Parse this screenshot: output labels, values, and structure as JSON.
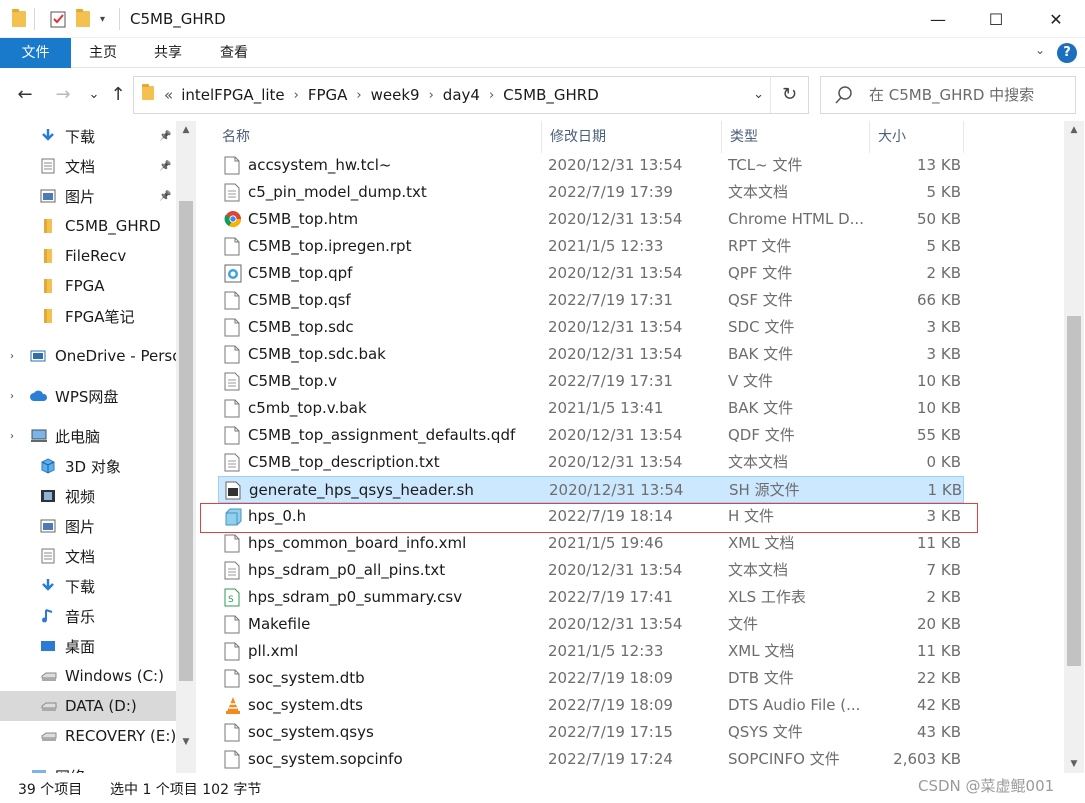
{
  "window": {
    "title": "C5MB_GHRD",
    "minimize": "—",
    "maximize": "☐",
    "close": "✕"
  },
  "ribbon": {
    "tabs": [
      "文件",
      "主页",
      "共享",
      "查看"
    ],
    "collapse": "⌄",
    "help": "?"
  },
  "address": {
    "back": "←",
    "forward": "→",
    "recent": "⌄",
    "up": "↑",
    "overflow": "«",
    "crumbs": [
      "intelFPGA_lite",
      "FPGA",
      "week9",
      "day4",
      "C5MB_GHRD"
    ],
    "dropdown": "⌄",
    "refresh": "↻"
  },
  "search": {
    "placeholder": "在 C5MB_GHRD 中搜索"
  },
  "nav": {
    "items": [
      {
        "label": "下载",
        "icon": "download-icon",
        "pinned": true
      },
      {
        "label": "文档",
        "icon": "document-icon",
        "pinned": true
      },
      {
        "label": "图片",
        "icon": "picture-icon",
        "pinned": true
      },
      {
        "label": "C5MB_GHRD",
        "icon": "folder-icon",
        "pinned": false
      },
      {
        "label": "FileRecv",
        "icon": "folder-icon",
        "pinned": false
      },
      {
        "label": "FPGA",
        "icon": "folder-icon",
        "pinned": false
      },
      {
        "label": "FPGA笔记",
        "icon": "folder-icon",
        "pinned": false
      },
      {
        "label": "OneDrive - Perso",
        "icon": "onedrive-icon",
        "pinned": false
      },
      {
        "label": "WPS网盘",
        "icon": "cloud-icon",
        "pinned": false
      },
      {
        "label": "此电脑",
        "icon": "computer-icon",
        "pinned": false
      },
      {
        "label": "3D 对象",
        "icon": "3d-objects-icon",
        "pinned": false
      },
      {
        "label": "视频",
        "icon": "video-icon",
        "pinned": false
      },
      {
        "label": "图片",
        "icon": "picture-icon",
        "pinned": false
      },
      {
        "label": "文档",
        "icon": "document-icon",
        "pinned": false
      },
      {
        "label": "下载",
        "icon": "download-icon",
        "pinned": false
      },
      {
        "label": "音乐",
        "icon": "music-icon",
        "pinned": false
      },
      {
        "label": "桌面",
        "icon": "desktop-icon",
        "pinned": false
      },
      {
        "label": "Windows (C:)",
        "icon": "drive-icon",
        "pinned": false
      },
      {
        "label": "DATA (D:)",
        "icon": "drive-icon",
        "pinned": false
      },
      {
        "label": "RECOVERY (E:)",
        "icon": "drive-icon",
        "pinned": false
      },
      {
        "label": "网络",
        "icon": "network-icon",
        "pinned": false
      }
    ],
    "pin_glyph": "📌",
    "selected_index": 18
  },
  "columns": {
    "name": "名称",
    "date": "修改日期",
    "type": "类型",
    "size": "大小"
  },
  "files": [
    {
      "name": "accsystem_hw.tcl~",
      "date": "2020/12/31 13:54",
      "type": "TCL~ 文件",
      "size": "13 KB",
      "icon": "file-icon"
    },
    {
      "name": "c5_pin_model_dump.txt",
      "date": "2022/7/19 17:39",
      "type": "文本文档",
      "size": "5 KB",
      "icon": "text-file-icon"
    },
    {
      "name": "C5MB_top.htm",
      "date": "2020/12/31 13:54",
      "type": "Chrome HTML D...",
      "size": "50 KB",
      "icon": "chrome-icon"
    },
    {
      "name": "C5MB_top.ipregen.rpt",
      "date": "2021/1/5 12:33",
      "type": "RPT 文件",
      "size": "5 KB",
      "icon": "file-icon"
    },
    {
      "name": "C5MB_top.qpf",
      "date": "2020/12/31 13:54",
      "type": "QPF 文件",
      "size": "2 KB",
      "icon": "quartus-project-icon"
    },
    {
      "name": "C5MB_top.qsf",
      "date": "2022/7/19 17:31",
      "type": "QSF 文件",
      "size": "66 KB",
      "icon": "file-icon"
    },
    {
      "name": "C5MB_top.sdc",
      "date": "2020/12/31 13:54",
      "type": "SDC 文件",
      "size": "3 KB",
      "icon": "file-icon"
    },
    {
      "name": "C5MB_top.sdc.bak",
      "date": "2020/12/31 13:54",
      "type": "BAK 文件",
      "size": "3 KB",
      "icon": "file-icon"
    },
    {
      "name": "C5MB_top.v",
      "date": "2022/7/19 17:31",
      "type": "V 文件",
      "size": "10 KB",
      "icon": "text-file-icon"
    },
    {
      "name": "c5mb_top.v.bak",
      "date": "2021/1/5 13:41",
      "type": "BAK 文件",
      "size": "10 KB",
      "icon": "file-icon"
    },
    {
      "name": "C5MB_top_assignment_defaults.qdf",
      "date": "2020/12/31 13:54",
      "type": "QDF 文件",
      "size": "55 KB",
      "icon": "file-icon"
    },
    {
      "name": "C5MB_top_description.txt",
      "date": "2020/12/31 13:54",
      "type": "文本文档",
      "size": "0 KB",
      "icon": "text-file-icon"
    },
    {
      "name": "generate_hps_qsys_header.sh",
      "date": "2020/12/31 13:54",
      "type": "SH 源文件",
      "size": "1 KB",
      "icon": "shell-script-icon"
    },
    {
      "name": "hps_0.h",
      "date": "2022/7/19 18:14",
      "type": "H 文件",
      "size": "3 KB",
      "icon": "header-file-icon"
    },
    {
      "name": "hps_common_board_info.xml",
      "date": "2021/1/5 19:46",
      "type": "XML 文档",
      "size": "11 KB",
      "icon": "file-icon"
    },
    {
      "name": "hps_sdram_p0_all_pins.txt",
      "date": "2020/12/31 13:54",
      "type": "文本文档",
      "size": "7 KB",
      "icon": "text-file-icon"
    },
    {
      "name": "hps_sdram_p0_summary.csv",
      "date": "2022/7/19 17:41",
      "type": "XLS 工作表",
      "size": "2 KB",
      "icon": "spreadsheet-icon"
    },
    {
      "name": "Makefile",
      "date": "2020/12/31 13:54",
      "type": "文件",
      "size": "20 KB",
      "icon": "file-icon"
    },
    {
      "name": "pll.xml",
      "date": "2021/1/5 12:33",
      "type": "XML 文档",
      "size": "11 KB",
      "icon": "file-icon"
    },
    {
      "name": "soc_system.dtb",
      "date": "2022/7/19 18:09",
      "type": "DTB 文件",
      "size": "22 KB",
      "icon": "file-icon"
    },
    {
      "name": "soc_system.dts",
      "date": "2022/7/19 18:09",
      "type": "DTS Audio File (...",
      "size": "42 KB",
      "icon": "vlc-icon"
    },
    {
      "name": "soc_system.qsys",
      "date": "2022/7/19 17:15",
      "type": "QSYS 文件",
      "size": "43 KB",
      "icon": "file-icon"
    },
    {
      "name": "soc_system.sopcinfo",
      "date": "2022/7/19 17:24",
      "type": "SOPCINFO 文件",
      "size": "2,603 KB",
      "icon": "file-icon"
    }
  ],
  "selected_file_index": 12,
  "status": {
    "count": "39 个项目",
    "selection": "选中 1 个项目  102 字节"
  },
  "watermark": "CSDN @菜虚鲲001",
  "colors": {
    "file_tab": "#1979ca",
    "selection_fill": "#cce8ff",
    "selection_border": "#99d1ff",
    "highlight_box": "#e04040",
    "folder": "#f4c04f"
  }
}
